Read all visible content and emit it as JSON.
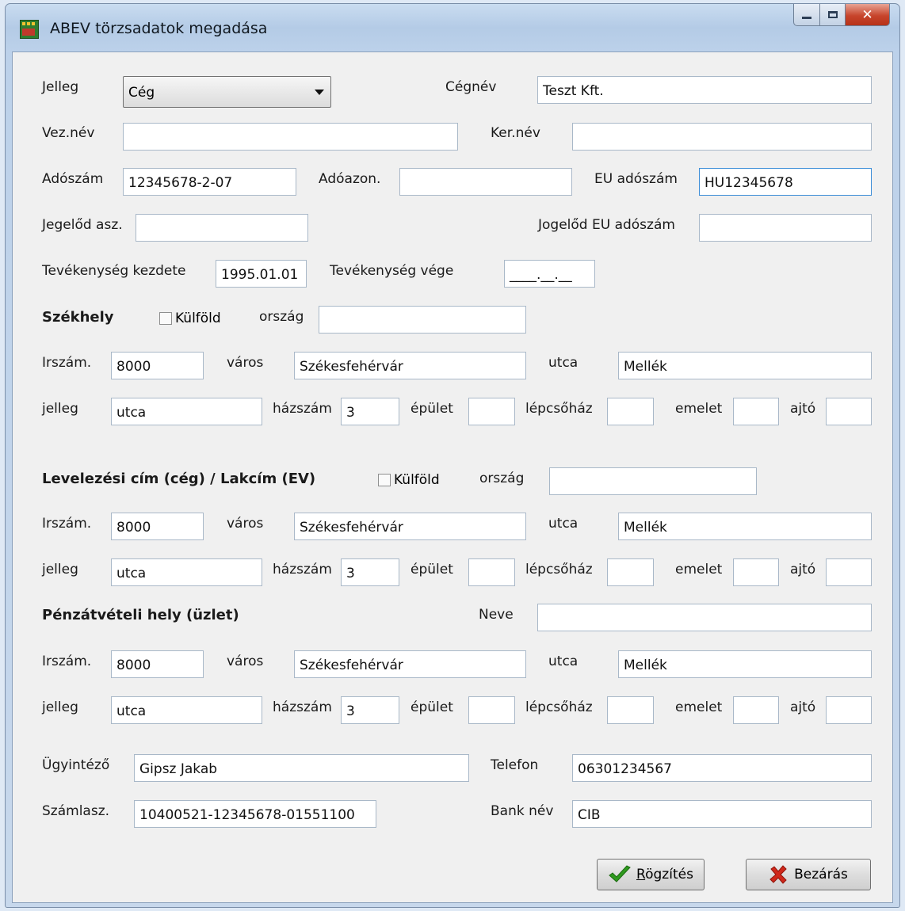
{
  "window": {
    "title": "ABEV törzsadatok megadása"
  },
  "general": {
    "jelleg_label": "Jelleg",
    "jelleg_value": "Cég",
    "cegnev_label": "Cégnév",
    "cegnev_value": "Teszt Kft.",
    "veznev_label": "Vez.név",
    "veznev_value": "",
    "kernev_label": "Ker.név",
    "kernev_value": "",
    "adoszam_label": "Adószám",
    "adoszam_value": "12345678-2-07",
    "adoazon_label": "Adóazon.",
    "adoazon_value": "",
    "eu_adoszam_label": "EU adószám",
    "eu_adoszam_value": "HU12345678",
    "jogelod_asz_label": "Jegelőd asz.",
    "jogelod_asz_value": "",
    "jogelod_eu_label": "Jogelőd EU adószám",
    "jogelod_eu_value": "",
    "tev_kezdete_label": "Tevékenység kezdete",
    "tev_kezdete_value": "1995.01.01",
    "tev_vege_label": "Tevékenység vége",
    "tev_vege_value": "____.__.__"
  },
  "szekhely": {
    "title": "Székhely",
    "kulfold_label": "Külföld",
    "orszag_label": "ország",
    "orszag_value": "",
    "irszam_label": "Irszám.",
    "irszam_value": "8000",
    "varos_label": "város",
    "varos_value": "Székesfehérvár",
    "utca_label": "utca",
    "utca_value": "Mellék",
    "jelleg_label": "jelleg",
    "jelleg_value": "utca",
    "hazszam_label": "házszám",
    "hazszam_value": "3",
    "epulet_label": "épület",
    "epulet_value": "",
    "lepcsohaz_label": "lépcsőház",
    "lepcsohaz_value": "",
    "emelet_label": "emelet",
    "emelet_value": "",
    "ajto_label": "ajtó",
    "ajto_value": ""
  },
  "levelezesi": {
    "title": "Levelezési cím (cég) / Lakcím (EV)",
    "kulfold_label": "Külföld",
    "orszag_label": "ország",
    "orszag_value": "",
    "irszam_label": "Irszám.",
    "irszam_value": "8000",
    "varos_label": "város",
    "varos_value": "Székesfehérvár",
    "utca_label": "utca",
    "utca_value": "Mellék",
    "jelleg_label": "jelleg",
    "jelleg_value": "utca",
    "hazszam_label": "házszám",
    "hazszam_value": "3",
    "epulet_label": "épület",
    "epulet_value": "",
    "lepcsohaz_label": "lépcsőház",
    "lepcsohaz_value": "",
    "emelet_label": "emelet",
    "emelet_value": "",
    "ajto_label": "ajtó",
    "ajto_value": ""
  },
  "penzatveteli": {
    "title": "Pénzátvételi hely (üzlet)",
    "neve_label": "Neve",
    "neve_value": "",
    "irszam_label": "Irszám.",
    "irszam_value": "8000",
    "varos_label": "város",
    "varos_value": "Székesfehérvár",
    "utca_label": "utca",
    "utca_value": "Mellék",
    "jelleg_label": "jelleg",
    "jelleg_value": "utca",
    "hazszam_label": "házszám",
    "hazszam_value": "3",
    "epulet_label": "épület",
    "epulet_value": "",
    "lepcsohaz_label": "lépcsőház",
    "lepcsohaz_value": "",
    "emelet_label": "emelet",
    "emelet_value": "",
    "ajto_label": "ajtó",
    "ajto_value": ""
  },
  "contact": {
    "ugyintezo_label": "Ügyintéző",
    "ugyintezo_value": "Gipsz Jakab",
    "telefon_label": "Telefon",
    "telefon_value": "06301234567",
    "szamlasz_label": "Számlasz.",
    "szamlasz_value": "10400521-12345678-01551100",
    "banknev_label": "Bank név",
    "banknev_value": "CIB"
  },
  "buttons": {
    "rogzites_first": "R",
    "rogzites_rest": "ögzítés",
    "bezaras": "Bezárás"
  },
  "colors": {
    "accent_check": "#2f9a1e",
    "close_x": "#d0281b"
  }
}
